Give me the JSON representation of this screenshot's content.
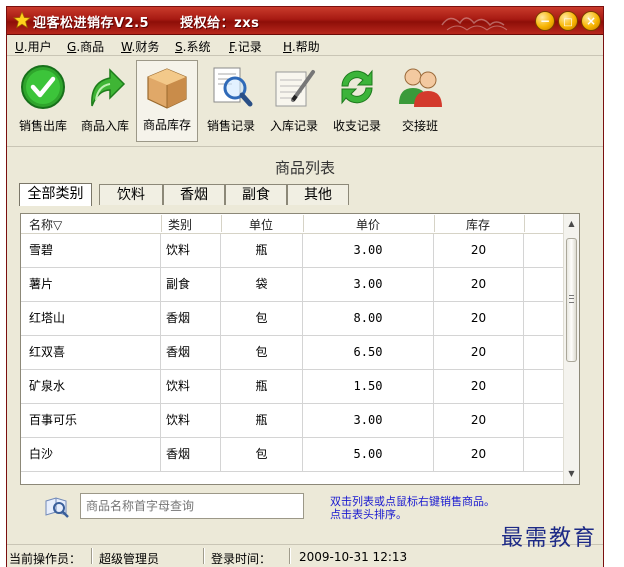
{
  "window": {
    "title": "迎客松进销存V2.5",
    "licensed_to": "授权给：zxs"
  },
  "menu": [
    {
      "key": "U",
      "label": ".用户"
    },
    {
      "key": "G",
      "label": ".商品"
    },
    {
      "key": "W",
      "label": ".财务"
    },
    {
      "key": "S",
      "label": ".系统"
    },
    {
      "key": "F",
      "label": ".记录"
    },
    {
      "key": "H",
      "label": ".帮助"
    }
  ],
  "toolbar": [
    {
      "label": "销售出库",
      "icon": "check-circle-icon"
    },
    {
      "label": "商品入库",
      "icon": "green-arrow-icon"
    },
    {
      "label": "商品库存",
      "icon": "box-icon",
      "active": true
    },
    {
      "label": "销售记录",
      "icon": "magnifier-document-icon"
    },
    {
      "label": "入库记录",
      "icon": "notepad-pen-icon"
    },
    {
      "label": "收支记录",
      "icon": "refresh-arrows-icon"
    },
    {
      "label": "交接班",
      "icon": "users-icon"
    }
  ],
  "section_title": "商品列表",
  "tabs": [
    {
      "label": "全部类别",
      "active": true
    },
    {
      "label": "饮料"
    },
    {
      "label": "香烟"
    },
    {
      "label": "副食"
    },
    {
      "label": "其他"
    }
  ],
  "table": {
    "headers": [
      "名称▽",
      "类别",
      "单位",
      "单价",
      "库存"
    ],
    "rows": [
      [
        "雪碧",
        "饮料",
        "瓶",
        "3.00",
        "20"
      ],
      [
        "薯片",
        "副食",
        "袋",
        "3.00",
        "20"
      ],
      [
        "红塔山",
        "香烟",
        "包",
        "8.00",
        "20"
      ],
      [
        "红双喜",
        "香烟",
        "包",
        "6.50",
        "20"
      ],
      [
        "矿泉水",
        "饮料",
        "瓶",
        "1.50",
        "20"
      ],
      [
        "百事可乐",
        "饮料",
        "瓶",
        "3.00",
        "20"
      ],
      [
        "白沙",
        "香烟",
        "包",
        "5.00",
        "20"
      ]
    ]
  },
  "search": {
    "placeholder": "商品名称首字母查询"
  },
  "hint_lines": [
    "双击列表或点鼠标右键销售商品。",
    "点击表头排序。"
  ],
  "status": {
    "operator_label": "当前操作员：",
    "operator_value": "超级管理员",
    "login_label": "登录时间：",
    "login_value": "2009-10-31  12:13"
  },
  "watermark": "最需教育",
  "colors": {
    "titlebar": "#a71a12",
    "window_bg": "#ece9d8",
    "hint_text": "#1a1ad0"
  }
}
